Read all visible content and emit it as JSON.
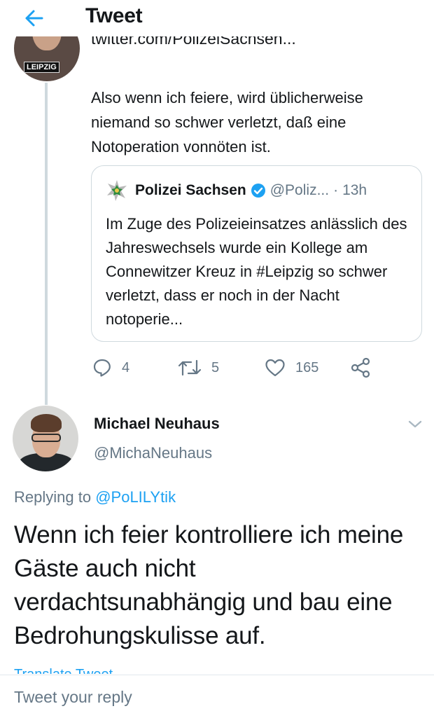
{
  "header": {
    "title": "Tweet",
    "back_icon": "arrow-left-icon",
    "accent": "#1da1f2"
  },
  "previous_tweet": {
    "link_text": "twitter.com/PolizeiSachsen...",
    "avatar_tag": "LEIPZIG",
    "text": "Also wenn ich feiere, wird üblicherweise niemand so schwer verletzt, daß eine Notoperation vonnöten ist.",
    "quote": {
      "name": "Polizei Sachsen",
      "handle": "@Poliz...",
      "dot": "·",
      "time": "13h",
      "text": "Im Zuge des Polizeieinsatzes anlässlich des Jahreswechsels wurde ein Kollege am Connewitzer Kreuz in #Leipzig so schwer verletzt, dass er noch in der Nacht notoperie..."
    },
    "actions": {
      "replies": "4",
      "retweets": "5",
      "likes": "165"
    }
  },
  "main_tweet": {
    "author_name": "Michael Neuhaus",
    "author_handle": "@MichaNeuhaus",
    "replying_prefix": "Replying to",
    "replying_mention": "@PoLILYtik",
    "text": "Wenn ich feier kontrolliere ich meine Gäste auch nicht verdachtsunabhängig und bau eine Bedrohungskulisse auf.",
    "translate_label": "Translate Tweet"
  },
  "reply_bar": {
    "placeholder": "Tweet your reply"
  },
  "colors": {
    "text": "#14171a",
    "muted": "#657786",
    "link": "#1da1f2",
    "border": "#cfd9de"
  }
}
